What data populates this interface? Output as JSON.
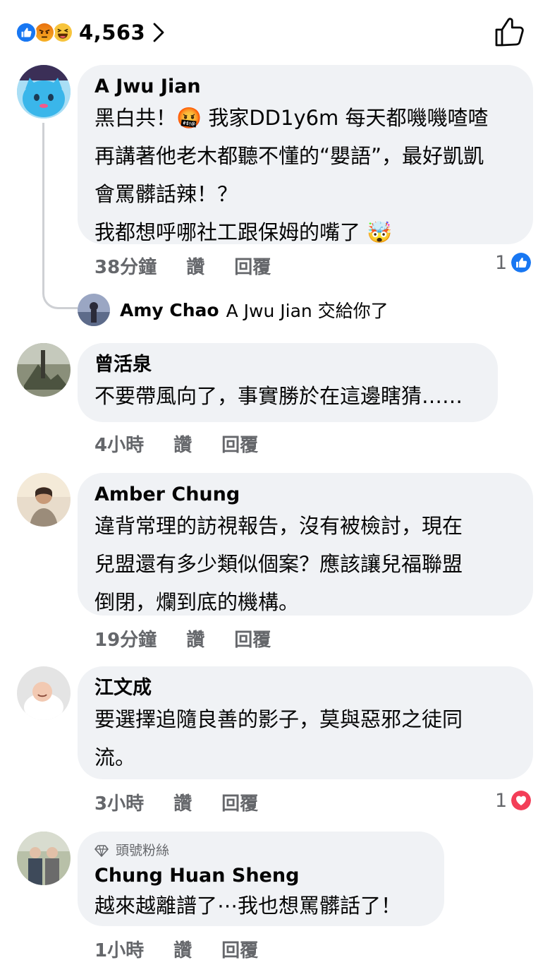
{
  "reactions": {
    "count": "4,563",
    "types": [
      "like-icon",
      "angry-icon",
      "haha-icon"
    ]
  },
  "comments": [
    {
      "author": "A Jwu Jian",
      "lines": [
        "黑白共！🤬 我家DD1y6m 每天都嘰嘰喳喳",
        "再講著他老木都聽不懂的“嬰語”，最好凱凱",
        "會罵髒話辣！？",
        "我都想呼哪社工跟保姆的嘴了 🤯"
      ],
      "time": "38分鐘",
      "like": "讚",
      "reply": "回覆",
      "reaction_count": "1",
      "reaction_type": "like-icon"
    },
    {
      "author": "曾活泉",
      "lines": [
        "不要帶風向了，事實勝於在這邊瞎猜……"
      ],
      "time": "4小時",
      "like": "讚",
      "reply": "回覆"
    },
    {
      "author": "Amber Chung",
      "lines": [
        "違背常理的訪視報告，沒有被檢討，現在",
        "兒盟還有多少類似個案？應該讓兒福聯盟",
        "倒閉，爛到底的機構。"
      ],
      "time": "19分鐘",
      "like": "讚",
      "reply": "回覆"
    },
    {
      "author": "江文成",
      "lines": [
        "要選擇追隨良善的影子，莫與惡邪之徒同",
        "流。"
      ],
      "time": "3小時",
      "like": "讚",
      "reply": "回覆",
      "reaction_count": "1",
      "reaction_type": "love-icon"
    },
    {
      "badge": "頭號粉絲",
      "author": "Chung Huan Sheng",
      "lines": [
        "越來越離譜了⋯我也想罵髒話了！"
      ],
      "time": "1小時",
      "like": "讚",
      "reply": "回覆"
    }
  ],
  "reply_preview": {
    "author": "Amy Chao",
    "text": "A Jwu Jian 交給你了"
  },
  "colors": {
    "like_blue": "#1877f2",
    "love_red": "#f33e58",
    "bubble_bg": "#f0f2f5",
    "meta_grey": "#65676b"
  }
}
